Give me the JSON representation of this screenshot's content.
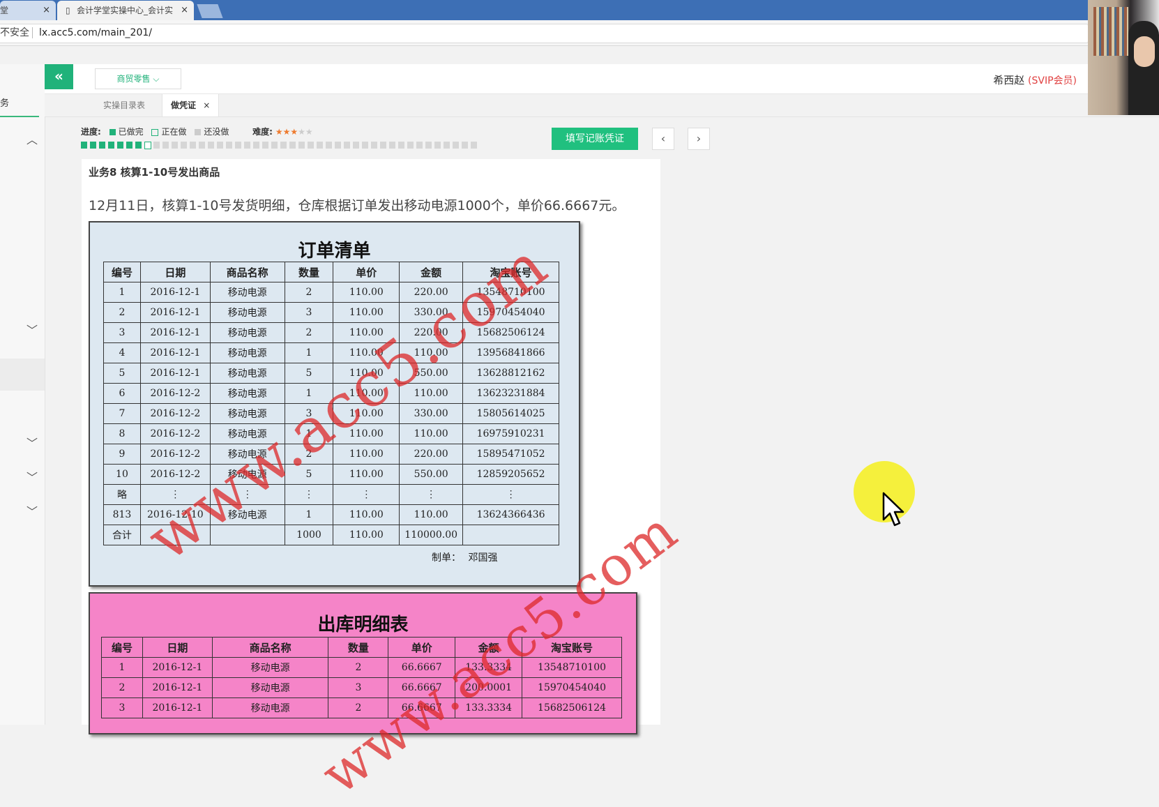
{
  "browser": {
    "tabs": [
      {
        "label": "堂",
        "active": false
      },
      {
        "label": "会计学堂实操中心_会计实",
        "active": true
      }
    ],
    "insecure_label": "不安全",
    "url": "lx.acc5.com/main_201/"
  },
  "sidebar": {
    "label": "务"
  },
  "header": {
    "collapse_glyph": "«",
    "category": "商贸零售 ⌵",
    "user_name": "希西赵",
    "user_badge": "(SVIP会员)"
  },
  "page_tabs": [
    {
      "label": "实操目录表",
      "active": false
    },
    {
      "label": "做凭证",
      "active": true,
      "close": "×"
    }
  ],
  "progress": {
    "label": "进度:",
    "done_label": "已做完",
    "doing_label": "正在做",
    "todo_label": "还没做",
    "difficulty_label": "难度:",
    "difficulty_stars": 3,
    "difficulty_max": 5,
    "done_count": 7,
    "current_index": 8,
    "total": 44,
    "colors": {
      "done": "#21b27a",
      "todo": "#d6d6d6"
    }
  },
  "actions": {
    "voucher_button": "填写记账凭证",
    "prev": "‹",
    "next": "›"
  },
  "task": {
    "title": "业务8 核算1-10号发出商品",
    "description": "12月11日，核算1-10号发货明细，仓库根据订单发出移动电源1000个，单价66.6667元。"
  },
  "order_list": {
    "title": "订单清单",
    "headers": [
      "编号",
      "日期",
      "商品名称",
      "数量",
      "单价",
      "金额",
      "淘宝账号"
    ],
    "rows": [
      [
        "1",
        "2016-12-1",
        "移动电源",
        "2",
        "110.00",
        "220.00",
        "13548710100"
      ],
      [
        "2",
        "2016-12-1",
        "移动电源",
        "3",
        "110.00",
        "330.00",
        "15970454040"
      ],
      [
        "3",
        "2016-12-1",
        "移动电源",
        "2",
        "110.00",
        "220.00",
        "15682506124"
      ],
      [
        "4",
        "2016-12-1",
        "移动电源",
        "1",
        "110.00",
        "110.00",
        "13956841866"
      ],
      [
        "5",
        "2016-12-1",
        "移动电源",
        "5",
        "110.00",
        "550.00",
        "13628812162"
      ],
      [
        "6",
        "2016-12-2",
        "移动电源",
        "1",
        "110.00",
        "110.00",
        "13623231884"
      ],
      [
        "7",
        "2016-12-2",
        "移动电源",
        "3",
        "110.00",
        "330.00",
        "15805614025"
      ],
      [
        "8",
        "2016-12-2",
        "移动电源",
        "1",
        "110.00",
        "110.00",
        "16975910231"
      ],
      [
        "9",
        "2016-12-2",
        "移动电源",
        "2",
        "110.00",
        "220.00",
        "15895471052"
      ],
      [
        "10",
        "2016-12-2",
        "移动电源",
        "5",
        "110.00",
        "550.00",
        "12859205652"
      ],
      [
        "略",
        "⋮",
        "⋮",
        "⋮",
        "⋮",
        "⋮",
        "⋮"
      ],
      [
        "813",
        "2016-12-10",
        "移动电源",
        "1",
        "110.00",
        "110.00",
        "13624366436"
      ],
      [
        "合计",
        "",
        "",
        "1000",
        "110.00",
        "110000.00",
        ""
      ]
    ],
    "maker_label": "制单：",
    "maker": "邓国强",
    "background": "#dde8f1"
  },
  "outbound_list": {
    "title": "出库明细表",
    "headers": [
      "编号",
      "日期",
      "商品名称",
      "数量",
      "单价",
      "金额",
      "淘宝账号"
    ],
    "rows": [
      [
        "1",
        "2016-12-1",
        "移动电源",
        "2",
        "66.6667",
        "133.3334",
        "13548710100"
      ],
      [
        "2",
        "2016-12-1",
        "移动电源",
        "3",
        "66.6667",
        "200.0001",
        "15970454040"
      ],
      [
        "3",
        "2016-12-1",
        "移动电源",
        "2",
        "66.6667",
        "133.3334",
        "15682506124"
      ]
    ],
    "background": "#f584c8"
  },
  "watermark": "www.acc5.com"
}
